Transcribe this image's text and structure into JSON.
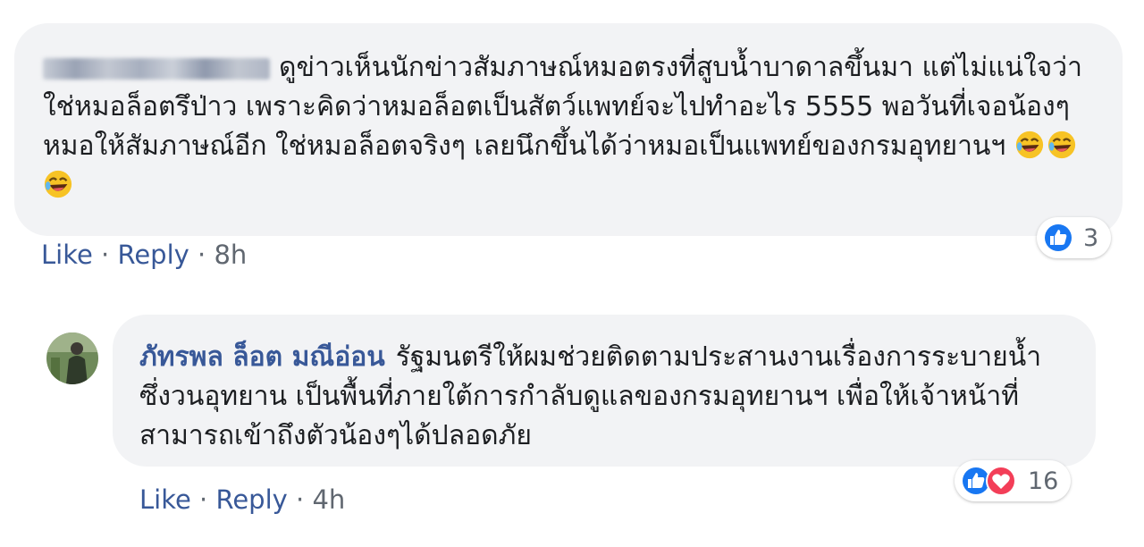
{
  "comment1": {
    "author_redacted": true,
    "text": "ดูข่าวเห็นนักข่าวสัมภาษณ์หมอตรงที่สูบน้ำบาดาลขึ้นมา แต่ไม่แน่ใจว่าใช่หมอล็อตรึป่าว เพราะคิดว่าหมอล็อตเป็นสัตว์แพทย์จะไปทำอะไร 5555 พอวันที่เจอน้องๆ หมอให้สัมภาษณ์อีก ใช่หมอล็อตจริงๆ เลยนึกขึ้นได้ว่าหมอเป็นแพทย์ของกรมอุทยานฯ",
    "emojis": [
      "laughing-emoji",
      "laughing-emoji",
      "laughing-emoji"
    ],
    "actions": {
      "like": "Like",
      "reply": "Reply",
      "time": "8h",
      "sep": "·"
    },
    "reactions": {
      "icons": [
        "like-icon"
      ],
      "count": "3"
    }
  },
  "comment2": {
    "author": "ภัทรพล ล็อต มณีอ่อน",
    "text": "รัฐมนตรีให้ผมช่วยติดตามประสานงานเรื่องการระบายน้ำ ซึ่งวนอุทยาน เป็นพื้นที่ภายใต้การกำลับดูแลของกรมอุทยานฯ เพื่อให้เจ้าหน้าที่สามารถเข้าถึงตัวน้องๆได้ปลอดภัย",
    "actions": {
      "like": "Like",
      "reply": "Reply",
      "time": "4h",
      "sep": "·"
    },
    "reactions": {
      "icons": [
        "like-icon",
        "love-icon"
      ],
      "count": "16"
    }
  },
  "colors": {
    "link": "#385898",
    "bubble": "#f2f3f5",
    "meta": "#606770",
    "like": "#1877f2",
    "love": "#f33e58"
  }
}
